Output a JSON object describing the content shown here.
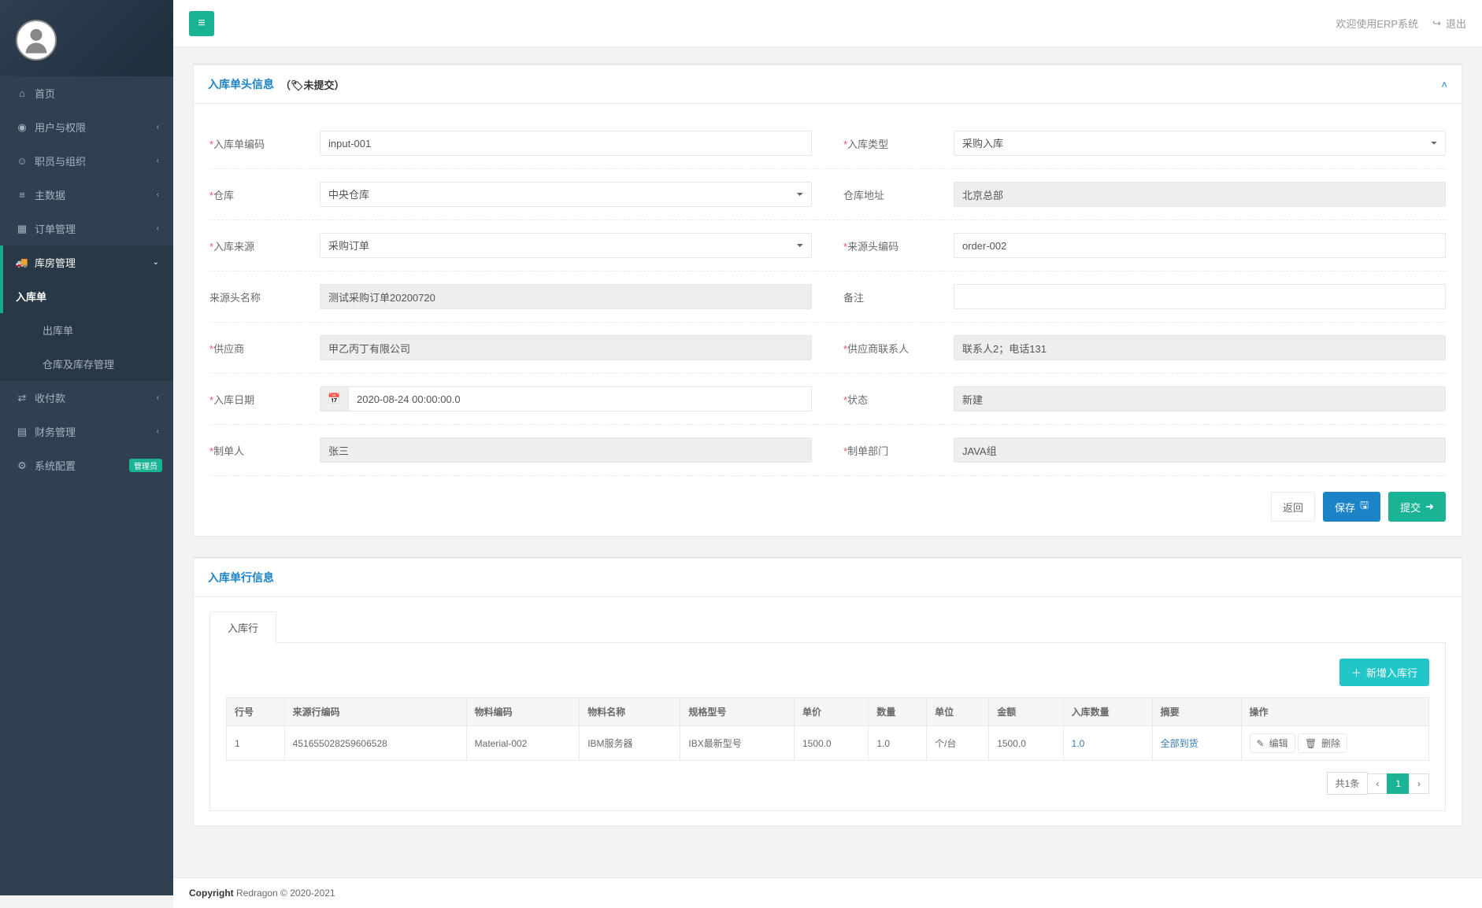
{
  "topbar": {
    "welcome": "欢迎使用ERP系统",
    "logout": "退出"
  },
  "sidebar": {
    "items": [
      {
        "icon": "home",
        "label": "首页",
        "expandable": false
      },
      {
        "icon": "dashboard",
        "label": "用户与权限",
        "expandable": true
      },
      {
        "icon": "person",
        "label": "职员与组织",
        "expandable": true
      },
      {
        "icon": "database",
        "label": "主数据",
        "expandable": true
      },
      {
        "icon": "calendar",
        "label": "订单管理",
        "expandable": true
      },
      {
        "icon": "truck",
        "label": "库房管理",
        "expandable": true,
        "active": true,
        "children": [
          {
            "label": "入库单",
            "active": true
          },
          {
            "label": "出库单"
          },
          {
            "label": "仓库及库存管理"
          }
        ]
      },
      {
        "icon": "exchange",
        "label": "收付款",
        "expandable": true
      },
      {
        "icon": "chart",
        "label": "财务管理",
        "expandable": true
      },
      {
        "icon": "gear",
        "label": "系统配置",
        "badge": "管理员"
      }
    ]
  },
  "panel_header": {
    "title": "入库单头信息",
    "status_prefix": "（",
    "status_text": "未提交",
    "status_suffix": "）"
  },
  "form": {
    "input_code": {
      "label": "入库单编码",
      "value": "input-001"
    },
    "input_type": {
      "label": "入库类型",
      "value": "采购入库"
    },
    "warehouse": {
      "label": "仓库",
      "value": "中央仓库"
    },
    "warehouse_addr": {
      "label": "仓库地址",
      "value": "北京总部"
    },
    "input_source": {
      "label": "入库来源",
      "value": "采购订单"
    },
    "source_head_code": {
      "label": "来源头编码",
      "value": "order-002"
    },
    "source_head_name": {
      "label": "来源头名称",
      "value": "测试采购订单20200720"
    },
    "memo": {
      "label": "备注",
      "value": ""
    },
    "supplier": {
      "label": "供应商",
      "value": "甲乙丙丁有限公司"
    },
    "supplier_contact": {
      "label": "供应商联系人",
      "value": "联系人2；电话131"
    },
    "input_date": {
      "label": "入库日期",
      "value": "2020-08-24 00:00:00.0"
    },
    "status": {
      "label": "状态",
      "value": "新建"
    },
    "creator": {
      "label": "制单人",
      "value": "张三"
    },
    "dept": {
      "label": "制单部门",
      "value": "JAVA组"
    }
  },
  "buttons": {
    "back": "返回",
    "save": "保存",
    "submit": "提交"
  },
  "line_panel": {
    "title": "入库单行信息",
    "tab": "入库行",
    "add_btn": "新增入库行"
  },
  "table": {
    "headers": [
      "行号",
      "来源行编码",
      "物料编码",
      "物料名称",
      "规格型号",
      "单价",
      "数量",
      "单位",
      "金额",
      "入库数量",
      "摘要",
      "操作"
    ],
    "rows": [
      {
        "cells": [
          "1",
          "451655028259606528",
          "Material-002",
          "IBM服务器",
          "IBX最新型号",
          "1500.0",
          "1.0",
          "个/台",
          "1500.0",
          "1.0",
          "全部到货"
        ]
      }
    ],
    "action_edit": "编辑",
    "action_delete": "删除"
  },
  "pagination": {
    "total": "共1条",
    "current": "1"
  },
  "footer": {
    "copyright_label": "Copyright",
    "copyright_text": " Redragon © 2020-2021"
  }
}
